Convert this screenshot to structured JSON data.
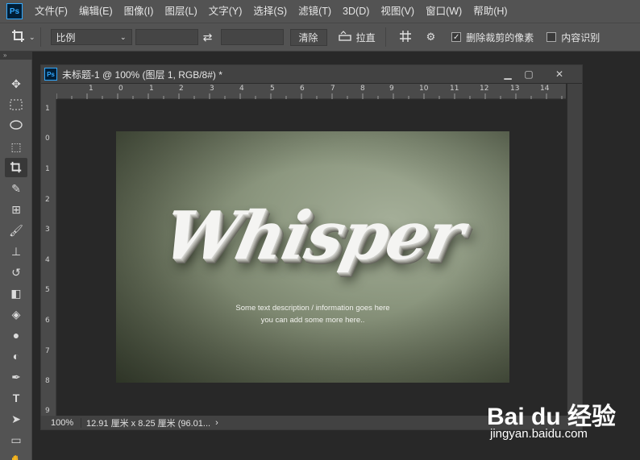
{
  "app": {
    "logo": "Ps"
  },
  "menu": {
    "items": [
      "文件(F)",
      "编辑(E)",
      "图像(I)",
      "图层(L)",
      "文字(Y)",
      "选择(S)",
      "滤镜(T)",
      "3D(D)",
      "视图(V)",
      "窗口(W)",
      "帮助(H)"
    ]
  },
  "options": {
    "ratio_value": "比例",
    "clear_label": "清除",
    "straighten_label": "拉直",
    "delete_cropped_label": "删除裁剪的像素",
    "delete_cropped_checked": true,
    "content_aware_label": "内容识别",
    "content_aware_checked": false
  },
  "document": {
    "logo": "Ps",
    "title": "未标题-1 @ 100% (图层 1, RGB/8#) *",
    "zoom": "100%",
    "size_info": "12.91 厘米 x 8.25 厘米 (96.01...",
    "ruler_top": [
      "1",
      "0",
      "1",
      "2",
      "3",
      "4",
      "5",
      "6",
      "7",
      "8",
      "9",
      "10",
      "11",
      "12",
      "13",
      "14"
    ],
    "ruler_left": [
      "1",
      "0",
      "1",
      "2",
      "3",
      "4",
      "5",
      "6",
      "7",
      "8",
      "9"
    ]
  },
  "artwork": {
    "headline": "Whisper",
    "line1": "Some text description / information goes here",
    "line2": "you can add some more here.."
  },
  "watermark": {
    "logo": "Bai du 经验",
    "url": "jingyan.baidu.com"
  },
  "colors": {
    "ps_blue": "#31a8ff",
    "ui_gray": "#535353",
    "canvas_bg": "#282828"
  }
}
